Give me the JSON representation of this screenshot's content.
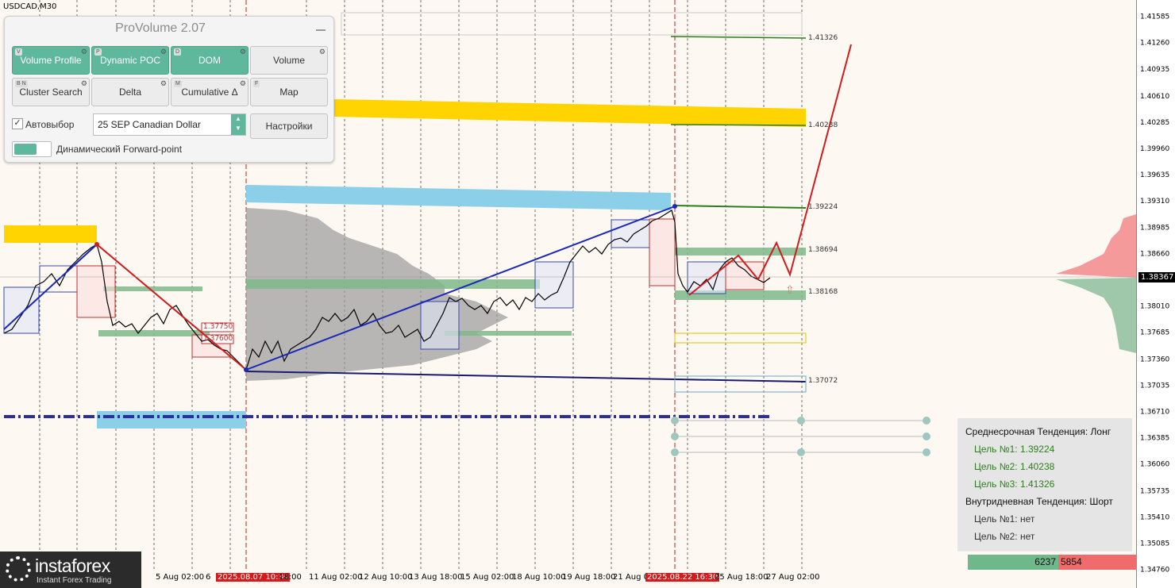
{
  "symbol": "USDCAD,M30",
  "panel": {
    "title": "ProVolume 2.07",
    "buttons": [
      {
        "label": "Volume Profile",
        "key": "V",
        "on": true
      },
      {
        "label": "Dynamic POC",
        "key": "P",
        "on": true
      },
      {
        "label": "DOM",
        "key": "D",
        "on": true
      },
      {
        "label": "Volume",
        "key": "",
        "on": false
      },
      {
        "label": "Cluster Search",
        "key": "B N",
        "on": false
      },
      {
        "label": "Delta",
        "key": "",
        "on": false
      },
      {
        "label": "Cumulative Δ",
        "key": "M",
        "on": false
      },
      {
        "label": "Map",
        "key": "F",
        "on": false
      }
    ],
    "auto_select_label": "Автовыбор",
    "instrument_value": "25 SEP Canadian Dollar",
    "settings_label": "Настройки",
    "forward_point_label": "Динамический Forward-point"
  },
  "y_axis": {
    "ticks": [
      "1.41585",
      "1.41260",
      "1.40935",
      "1.40610",
      "1.40285",
      "1.39960",
      "1.39635",
      "1.39310",
      "1.38985",
      "1.38660",
      "1.38335",
      "1.38010",
      "1.37685",
      "1.37360",
      "1.37035",
      "1.36710",
      "1.36385",
      "1.36060",
      "1.35735",
      "1.35410",
      "1.35085",
      "1.34760"
    ],
    "current_price": "1.38367"
  },
  "x_axis": [
    {
      "label": "5 Aug 02:00",
      "hl": false
    },
    {
      "label": "6",
      "hl": false
    },
    {
      "label": "2025.08.07 10:30",
      "hl": true
    },
    {
      "label": "18:00",
      "hl": false
    },
    {
      "label": "11 Aug 02:00",
      "hl": false
    },
    {
      "label": "12 Aug 10:00",
      "hl": false
    },
    {
      "label": "13 Aug 18:00",
      "hl": false
    },
    {
      "label": "15 Aug 02:00",
      "hl": false
    },
    {
      "label": "18 Aug 10:00",
      "hl": false
    },
    {
      "label": "19 Aug 18:00",
      "hl": false
    },
    {
      "label": "21 Aug 0",
      "hl": false
    },
    {
      "label": "2025.08.22 16:30",
      "hl": true
    },
    {
      "label": "25 Aug 18:00",
      "hl": false
    },
    {
      "label": "27 Aug 02:00",
      "hl": false
    }
  ],
  "levels": {
    "l1": "1.41326",
    "l2": "1.40238",
    "l3": "1.39224",
    "l4": "1.38694",
    "l5": "1.38168",
    "l6": "1.37072",
    "box_a": "1.37750",
    "box_b": "1.37600"
  },
  "info": {
    "mid_trend": "Среднесрочная Тенденция: Лонг",
    "t1": "Цель №1: 1.39224",
    "t2": "Цель №2: 1.40238",
    "t3": "Цель №3: 1.41326",
    "intra_trend": "Внутридневная Тенденция: Шорт",
    "i1": "Цель №1: нет",
    "i2": "Цель №2: нет"
  },
  "volume_bar": {
    "buy": "6237",
    "sell": "5854"
  },
  "logo": {
    "name": "instaforex",
    "tagline": "Instant Forex Trading"
  },
  "colors": {
    "up_trend": "#1a28b8",
    "down_trend": "#d01c1c",
    "target_green": "#2e7d1f",
    "yellow_zone": "#ffd400",
    "blue_zone": "#8ccfe8",
    "poc_green": "#7fb98a"
  }
}
